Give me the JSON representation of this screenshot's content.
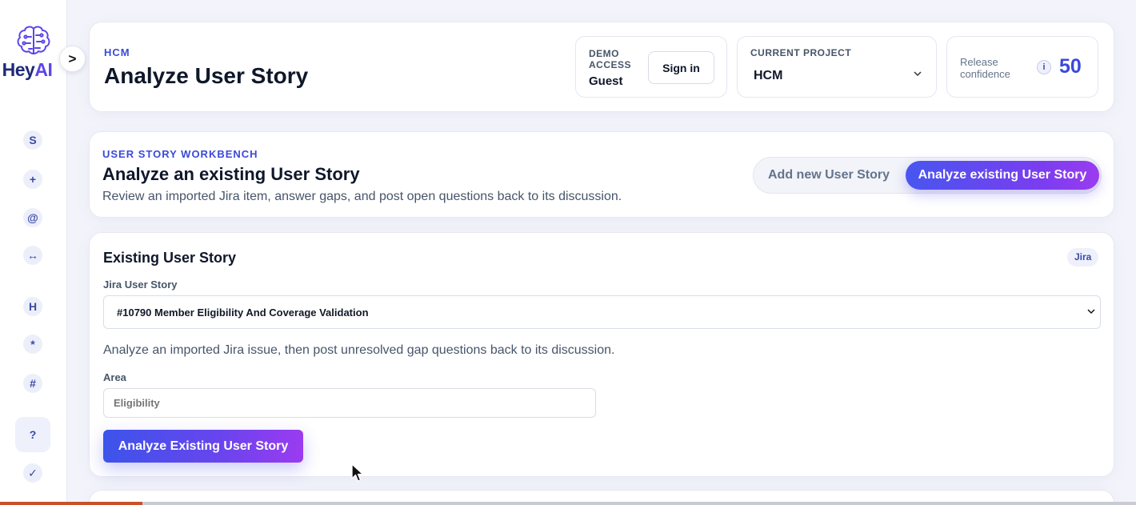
{
  "brand": {
    "name_prefix": "Hey",
    "name_suffix": "AI"
  },
  "sidebar": {
    "collapse_label": ">",
    "items": [
      {
        "label": "S"
      },
      {
        "label": "+"
      },
      {
        "label": "@"
      },
      {
        "label": "↔"
      },
      {
        "label": "H"
      },
      {
        "label": "*"
      },
      {
        "label": "#"
      },
      {
        "label": "?"
      },
      {
        "label": "✓"
      }
    ]
  },
  "header": {
    "eyebrow": "HCM",
    "title": "Analyze User Story",
    "demo": {
      "label": "DEMO ACCESS",
      "user": "Guest",
      "signin_label": "Sign in"
    },
    "project": {
      "label": "CURRENT PROJECT",
      "value": "HCM"
    },
    "confidence": {
      "label": "Release confidence",
      "info": "i",
      "value": "50"
    }
  },
  "workbench": {
    "eyebrow": "USER STORY WORKBENCH",
    "title": "Analyze an existing User Story",
    "description": "Review an imported Jira item, answer gaps, and post open questions back to its discussion.",
    "modes": {
      "add_label": "Add new User Story",
      "analyze_label": "Analyze existing User Story"
    }
  },
  "existing_story": {
    "title": "Existing User Story",
    "badge": "Jira",
    "jira_label": "Jira User Story",
    "selected_story": "#10790 Member Eligibility And Coverage Validation",
    "hint": "Analyze an imported Jira issue, then post unresolved gap questions back to its discussion.",
    "area_label": "Area",
    "area_placeholder": "Eligibility",
    "submit_label": "Analyze Existing User Story"
  },
  "progress": {
    "fraction": 0.125
  },
  "colors": {
    "accent": "#3b4ad8",
    "gradient_start": "#4856ef",
    "gradient_end": "#9b3cf0",
    "progress": "#c9502a"
  }
}
